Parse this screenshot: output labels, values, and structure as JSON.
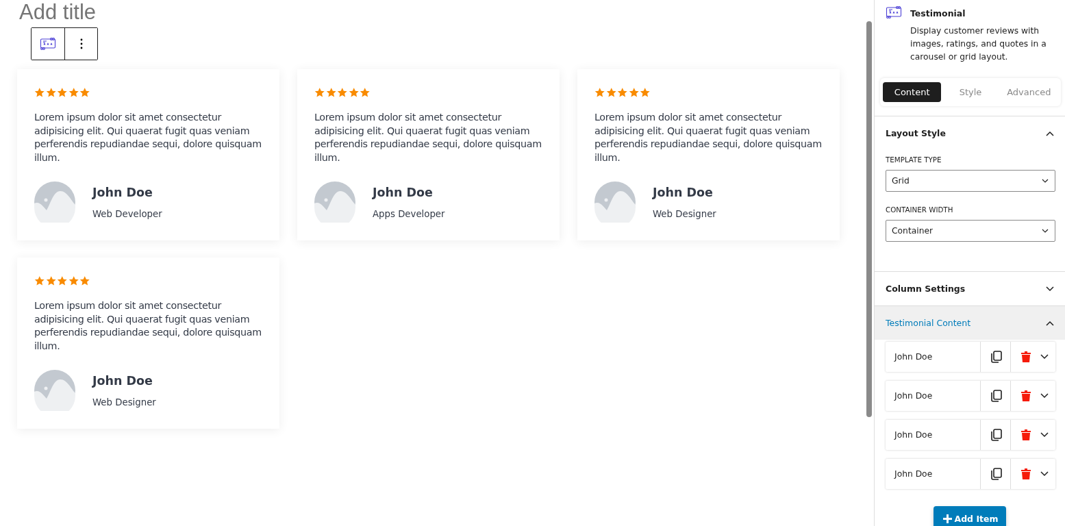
{
  "page_title": "Add title",
  "testimonials": [
    {
      "stars": 5,
      "quote": "Lorem ipsum dolor sit amet consectetur adipisicing elit. Qui quaerat fugit quas veniam perferendis repudiandae sequi, dolore quisquam illum.",
      "name": "John Doe",
      "role": "Web Developer"
    },
    {
      "stars": 5,
      "quote": "Lorem ipsum dolor sit amet consectetur adipisicing elit. Qui quaerat fugit quas veniam perferendis repudiandae sequi, dolore quisquam illum.",
      "name": "John Doe",
      "role": "Apps Developer"
    },
    {
      "stars": 5,
      "quote": "Lorem ipsum dolor sit amet consectetur adipisicing elit. Qui quaerat fugit quas veniam perferendis repudiandae sequi, dolore quisquam illum.",
      "name": "John Doe",
      "role": "Web Designer"
    },
    {
      "stars": 5,
      "quote": "Lorem ipsum dolor sit amet consectetur adipisicing elit. Qui quaerat fugit quas veniam perferendis repudiandae sequi, dolore quisquam illum.",
      "name": "John Doe",
      "role": "Web Designer"
    }
  ],
  "sidebar": {
    "block_title": "Testimonial",
    "block_description": "Display customer reviews with images, ratings, and quotes in a carousel or grid layout.",
    "tabs": [
      {
        "label": "Content",
        "selected": true
      },
      {
        "label": "Style",
        "selected": false
      },
      {
        "label": "Advanced",
        "selected": false
      }
    ],
    "panels": [
      {
        "kind": "fields",
        "title": "Layout Style",
        "expanded": true,
        "selected": false,
        "fields": [
          {
            "label": "TEMPLATE TYPE",
            "value": "Grid"
          },
          {
            "label": "CONTAINER WIDTH",
            "value": "Container"
          }
        ]
      },
      {
        "kind": "fields",
        "title": "Column Settings",
        "expanded": false,
        "selected": false
      },
      {
        "kind": "items",
        "title": "Testimonial Content",
        "expanded": true,
        "selected": true,
        "items": [
          "John Doe",
          "John Doe",
          "John Doe",
          "John Doe"
        ],
        "add_button": "Add Item"
      }
    ]
  }
}
